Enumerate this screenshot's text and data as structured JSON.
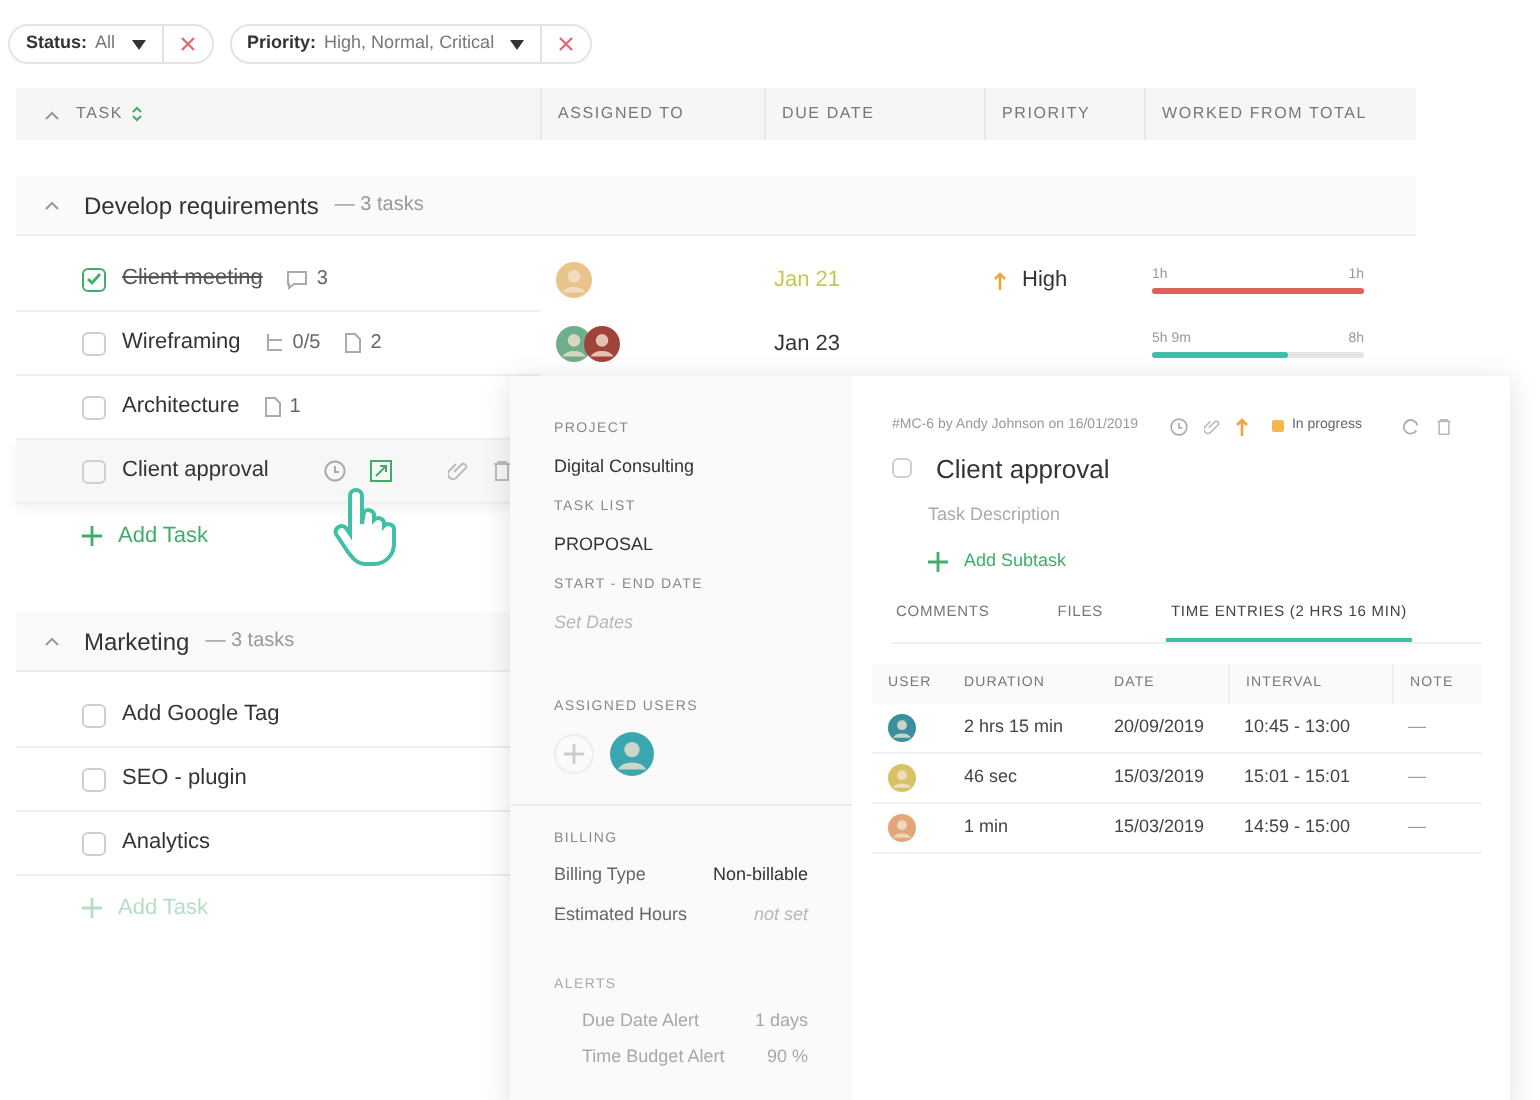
{
  "filters": [
    {
      "label": "Status:",
      "value": "All"
    },
    {
      "label": "Priority:",
      "value": "High, Normal, Critical"
    }
  ],
  "columns": [
    "TASK",
    "ASSIGNED TO",
    "DUE DATE",
    "PRIORITY",
    "WORKED FROM TOTAL"
  ],
  "groups": [
    {
      "title": "Develop requirements",
      "count": "— 3 tasks",
      "expanded": true,
      "add_task": {
        "label": "Add Task",
        "faded": false
      },
      "tasks": [
        {
          "name": "Client meeting",
          "checked": true,
          "hovered": false,
          "meta": [
            {
              "kind": "comments",
              "text": "3"
            }
          ],
          "avatars": [
            {
              "color": "#e8c48a"
            }
          ],
          "due": {
            "text": "Jan 21",
            "color": "#c5c94f"
          },
          "priority": "High",
          "worked": {
            "from": "1h",
            "total": "1h",
            "level": 1,
            "color": "#e0605a"
          }
        },
        {
          "name": "Wireframing",
          "checked": false,
          "hovered": false,
          "meta": [
            {
              "kind": "subtasks",
              "text": "0/5"
            },
            {
              "kind": "files",
              "text": "2"
            }
          ],
          "avatars": [
            {
              "color": "#6fae8c"
            },
            {
              "color": "#a0443a"
            }
          ],
          "due": {
            "text": "Jan 23",
            "color": "#333333"
          },
          "worked": {
            "from": "5h 9m",
            "total": "8h",
            "level": 0.64,
            "color": "#3fbfa5"
          }
        },
        {
          "name": "Architecture",
          "checked": false,
          "hovered": false,
          "meta": [
            {
              "kind": "files",
              "text": "1"
            }
          ]
        },
        {
          "name": "Client approval",
          "checked": false,
          "hovered": true
        }
      ]
    },
    {
      "title": "Marketing",
      "count": "— 3 tasks",
      "expanded": true,
      "add_task": {
        "label": "Add Task",
        "faded": true
      },
      "tasks": [
        {
          "name": "Add Google Tag",
          "checked": false,
          "hovered": false
        },
        {
          "name": "SEO - plugin",
          "checked": false,
          "hovered": false
        },
        {
          "name": "Analytics",
          "checked": false,
          "hovered": false
        }
      ]
    }
  ],
  "detail": {
    "sections": [
      {
        "label": "PROJECT",
        "value": "Digital Consulting"
      },
      {
        "label": "TASK LIST",
        "value": "PROPOSAL"
      },
      {
        "label": "START - END DATE",
        "placeholder": "Set Dates"
      }
    ],
    "assigned_label": "ASSIGNED USERS",
    "assigned": [
      {
        "color": "#3aa6b0"
      }
    ],
    "billing": {
      "label": "BILLING",
      "rows": [
        {
          "label": "Billing Type",
          "value": "Non-billable"
        },
        {
          "label": "Estimated Hours",
          "placeholder": "not set"
        }
      ]
    },
    "alerts": {
      "label": "ALERTS",
      "rows": [
        {
          "label": "Due Date Alert",
          "value": "1 days"
        },
        {
          "label": "Time Budget Alert",
          "value": "90 %"
        }
      ]
    },
    "meta": "#MC-6 by Andy Johnson on 16/01/2019",
    "status": {
      "text": "In progress",
      "color": "#f2b84b"
    },
    "title": "Client approval",
    "checked": false,
    "description_placeholder": "Task Description",
    "add_subtask": "Add Subtask",
    "tabs": [
      {
        "label": "COMMENTS",
        "selected": false
      },
      {
        "label": "FILES",
        "selected": false
      },
      {
        "label": "TIME ENTRIES (2 HRS 16 MIN)",
        "selected": true
      }
    ],
    "entry_columns": [
      "USER",
      "DURATION",
      "DATE",
      "INTERVAL",
      "NOTE"
    ],
    "entries": [
      {
        "user": {
          "color": "#3a8fa0"
        },
        "duration": "2 hrs 15 min",
        "date": "20/09/2019",
        "interval": "10:45 - 13:00",
        "note": "—"
      },
      {
        "user": {
          "color": "#d9c266"
        },
        "duration": "46 sec",
        "date": "15/03/2019",
        "interval": "15:01 - 15:01",
        "note": "—"
      },
      {
        "user": {
          "color": "#e2a679"
        },
        "duration": "1 min",
        "date": "15/03/2019",
        "interval": "14:59 - 15:00",
        "note": "—"
      }
    ]
  }
}
